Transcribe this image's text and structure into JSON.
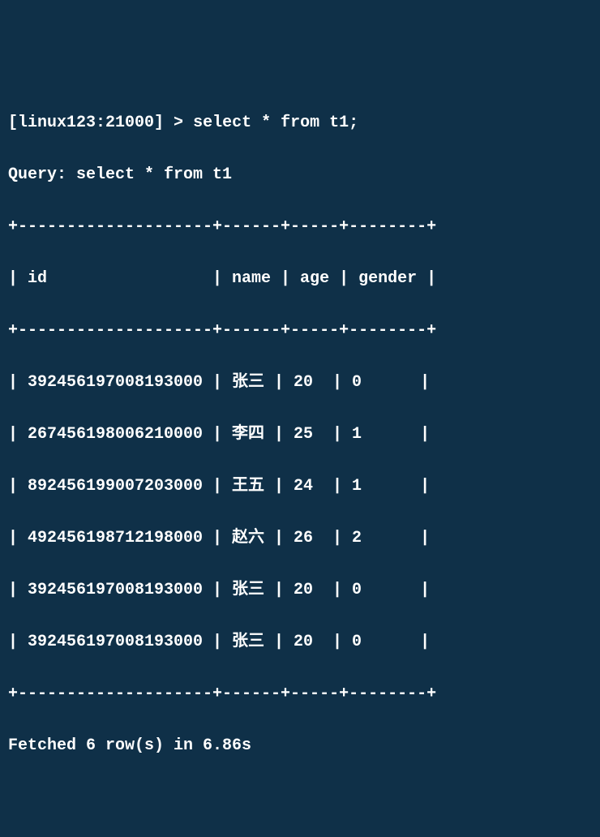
{
  "prompt": {
    "host": "[linux123:21000]",
    "cursor": ">",
    "command": "select * from t1;"
  },
  "query_echo": "Query: select * from t1",
  "table": {
    "columns": [
      "id",
      "name",
      "age",
      "gender"
    ],
    "separator_top": "+--------------------+------+-----+--------+",
    "header_line": "| id                 | name | age | gender |",
    "separator_mid": "+--------------------+------+-----+--------+",
    "rows": [
      {
        "id": "392456197008193000",
        "name": "张三",
        "age": "20",
        "gender": "0"
      },
      {
        "id": "267456198006210000",
        "name": "李四",
        "age": "25",
        "gender": "1"
      },
      {
        "id": "892456199007203000",
        "name": "王五",
        "age": "24",
        "gender": "1"
      },
      {
        "id": "492456198712198000",
        "name": "赵六",
        "age": "26",
        "gender": "2"
      },
      {
        "id": "392456197008193000",
        "name": "张三",
        "age": "20",
        "gender": "0"
      },
      {
        "id": "392456197008193000",
        "name": "张三",
        "age": "20",
        "gender": "0"
      }
    ],
    "row_lines": [
      "| 392456197008193000 | 张三 | 20  | 0      |",
      "| 267456198006210000 | 李四 | 25  | 1      |",
      "| 892456199007203000 | 王五 | 24  | 1      |",
      "| 492456198712198000 | 赵六 | 26  | 2      |",
      "| 392456197008193000 | 张三 | 20  | 0      |",
      "| 392456197008193000 | 张三 | 20  | 0      |"
    ],
    "separator_bot": "+--------------------+------+-----+--------+"
  },
  "footer": "Fetched 6 row(s) in 6.86s",
  "chart_data": {
    "type": "table",
    "columns": [
      "id",
      "name",
      "age",
      "gender"
    ],
    "rows": [
      [
        "392456197008193000",
        "张三",
        20,
        0
      ],
      [
        "267456198006210000",
        "李四",
        25,
        1
      ],
      [
        "892456199007203000",
        "王五",
        24,
        1
      ],
      [
        "492456198712198000",
        "赵六",
        26,
        2
      ],
      [
        "392456197008193000",
        "张三",
        20,
        0
      ],
      [
        "392456197008193000",
        "张三",
        20,
        0
      ]
    ]
  }
}
